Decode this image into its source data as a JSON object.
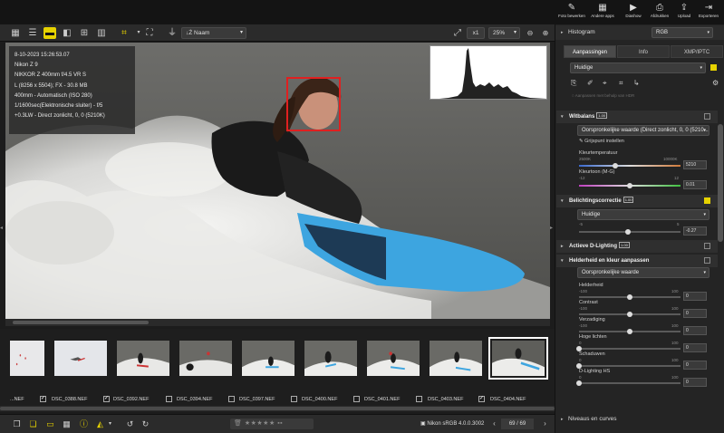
{
  "topbar": {
    "buttons": [
      {
        "label": "Foto bewerken",
        "icon": "photo-edit-icon",
        "glyph": "✎"
      },
      {
        "label": "Andere apps",
        "icon": "apps-icon",
        "glyph": "▦"
      },
      {
        "label": "Diashow",
        "icon": "slideshow-icon",
        "glyph": "▶"
      },
      {
        "label": "Afdrukken",
        "icon": "print-icon",
        "glyph": "⎙"
      },
      {
        "label": "Upload",
        "icon": "upload-icon",
        "glyph": "⇪"
      },
      {
        "label": "Exporteren",
        "icon": "export-icon",
        "glyph": "⇥"
      }
    ]
  },
  "toolbar": {
    "sort_label": "Naam",
    "sort_prefix": "↓Ż",
    "zoom_value": "25%",
    "zoom_prefix": "x1"
  },
  "viewer": {
    "info_lines": [
      "8-10-2023 15:26:53.07",
      "Nikon Z 9",
      "NIKKOR Z 400mm f/4.5 VR S",
      "L (8256 x 5504); FX - 30.8 MB",
      "400mm - Automatisch (ISO 280)",
      "1/1600sec(Elektronische sluiter) - f/5",
      "+0.3LW - Direct zonlicht, 0, 0 (5210K)"
    ]
  },
  "filmstrip": {
    "items": [
      {
        "name": "...NEF",
        "checked": true
      },
      {
        "name": "DSC_0388.NEF",
        "checked": true
      },
      {
        "name": "DSC_0392.NEF",
        "checked": false
      },
      {
        "name": "DSC_0394.NEF",
        "checked": false
      },
      {
        "name": "DSC_0397.NEF",
        "checked": false
      },
      {
        "name": "DSC_0400.NEF",
        "checked": false
      },
      {
        "name": "DSC_0401.NEF",
        "checked": false
      },
      {
        "name": "DSC_0403.NEF",
        "checked": true
      },
      {
        "name": "DSC_0404.NEF",
        "checked": false
      }
    ]
  },
  "bottombar": {
    "stars": "★★★★★",
    "profile": "Nikon sRGB 4.0.0.3002",
    "counter": "69 / 69"
  },
  "panel": {
    "histogram_label": "Histogram",
    "histogram_mode": "RGB",
    "tabs": [
      "Aanpassingen",
      "Info",
      "XMP/IPTC"
    ],
    "preset_value": "Huidige",
    "hidden_option": "Aanpassen met behulp van HDR",
    "whitebalance": {
      "title": "Witbalans",
      "badge": "1.00",
      "mode": "Oorspronkelijke waarde (Direct zonlicht, 0, 0 (5210...",
      "greypoint": "Grijspunt instellen",
      "temp_label": "Kleurtemperatuur",
      "temp_min": "2500K",
      "temp_max": "10000K",
      "temp_value": "5210",
      "temp_level": 0.36,
      "tint_label": "Kleurtoon (M-G)",
      "tint_min": "-12",
      "tint_max": "12",
      "tint_value": "0.01",
      "tint_level": 0.5
    },
    "exposure": {
      "title": "Belichtingscorrectie",
      "badge": "1.00",
      "preset": "Huidige",
      "min": "-5",
      "max": "5",
      "value": "-0.27",
      "level": 0.48
    },
    "adl": {
      "title": "Actieve D-Lighting",
      "badge": "1.00"
    },
    "brightness": {
      "title": "Helderheid en kleur aanpassen",
      "preset": "Oorspronkelijke waarde",
      "sliders": [
        {
          "label": "Helderheid",
          "min": "-100",
          "max": "100",
          "value": "0",
          "level": 0.5
        },
        {
          "label": "Contrast",
          "min": "-100",
          "max": "100",
          "value": "0",
          "level": 0.5
        },
        {
          "label": "Verzadiging",
          "min": "-100",
          "max": "100",
          "value": "0",
          "level": 0.5
        },
        {
          "label": "Hoge lichten",
          "min": "0",
          "max": "100",
          "value": "0",
          "level": 0.0
        },
        {
          "label": "Schaduwen",
          "min": "0",
          "max": "100",
          "value": "0",
          "level": 0.0
        },
        {
          "label": "D-Lighting HS",
          "min": "0",
          "max": "100",
          "value": "0",
          "level": 0.0
        }
      ]
    },
    "levels_title": "Niveaus en curves"
  }
}
